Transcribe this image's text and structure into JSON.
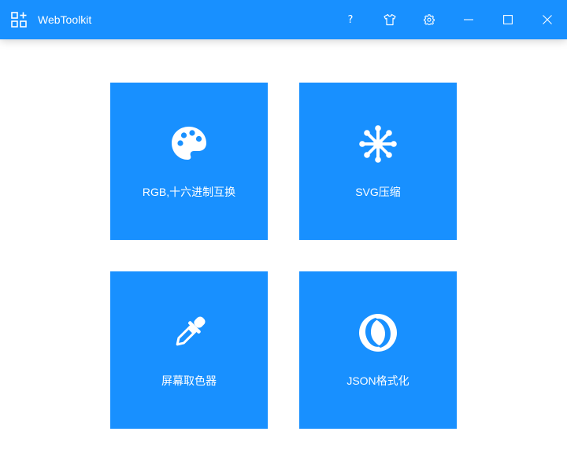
{
  "window": {
    "title": "WebToolkit",
    "accent_color": "#1890ff",
    "icons": {
      "logo": "apps-grid-plus-icon",
      "help": "question-icon",
      "skin": "tshirt-icon",
      "settings": "gear-icon",
      "minimize": "minimize-icon",
      "maximize": "maximize-icon",
      "close": "close-icon"
    }
  },
  "tools": [
    {
      "label": "RGB,十六进制互换",
      "icon": "palette-icon"
    },
    {
      "label": "SVG压缩",
      "icon": "asterisk-icon"
    },
    {
      "label": "屏幕取色器",
      "icon": "eyedropper-icon"
    },
    {
      "label": "JSON格式化",
      "icon": "json-logo-icon"
    }
  ]
}
